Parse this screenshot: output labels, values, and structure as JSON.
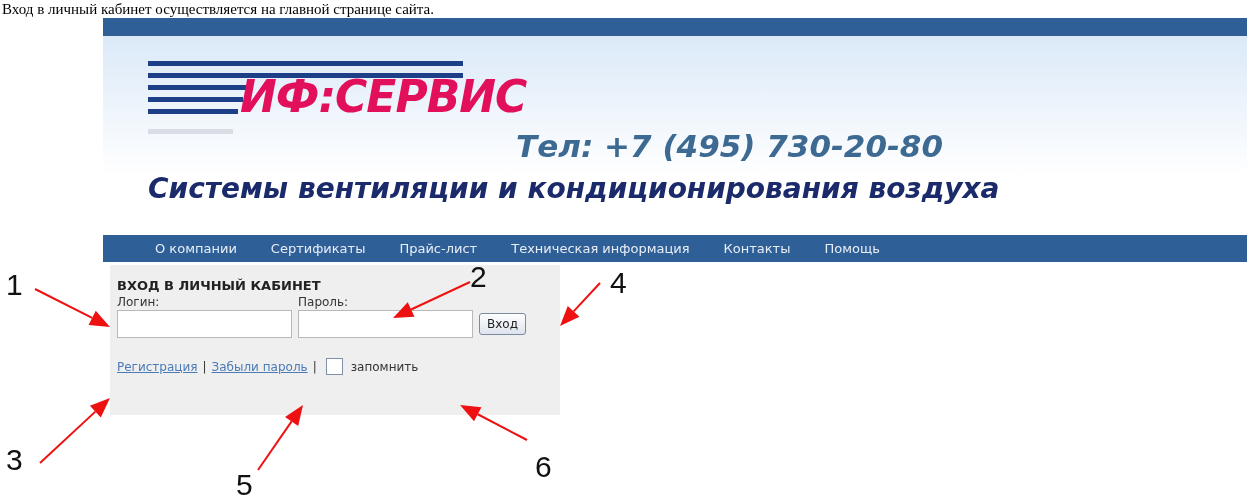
{
  "caption": "Вход в личный кабинет осуществляется на главной странице сайта.",
  "header": {
    "logo_text": "ИФ:СЕРВИС",
    "phone": "Тел: +7 (495) 730-20-80",
    "tagline": "Системы вентиляции и кондиционирования воздуха"
  },
  "nav": [
    "О компании",
    "Сертификаты",
    "Прайс-лист",
    "Техническая информация",
    "Контакты",
    "Помощь"
  ],
  "login": {
    "title": "ВХОД В ЛИЧНЫЙ КАБИНЕТ",
    "login_label": "Логин:",
    "password_label": "Пароль:",
    "submit": "Вход",
    "links": [
      "Регистрация",
      "Забыли пароль"
    ],
    "separator": "|",
    "remember": {
      "label": "запомнить",
      "checked": false
    }
  },
  "annotations": [
    {
      "label": "1"
    },
    {
      "label": "2"
    },
    {
      "label": "4"
    },
    {
      "label": "3"
    },
    {
      "label": "5"
    },
    {
      "label": "6"
    }
  ]
}
